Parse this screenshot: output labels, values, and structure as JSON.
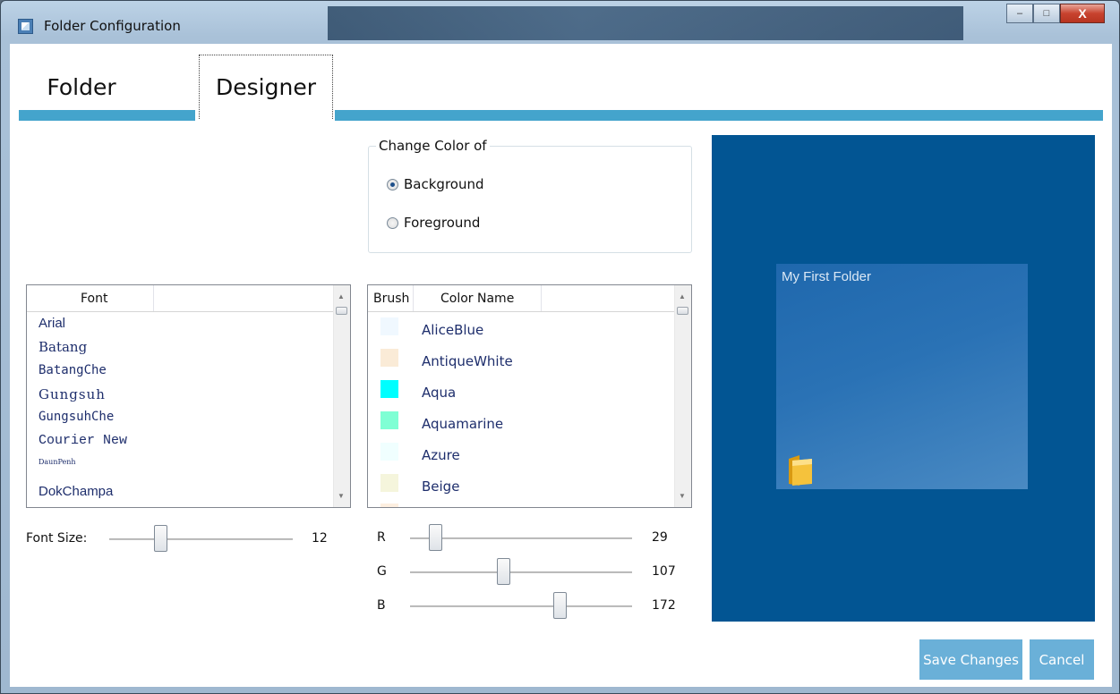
{
  "window": {
    "title": "Folder Configuration",
    "controls": {
      "minimize": "‒",
      "maximize": "□",
      "close": "X"
    }
  },
  "tabs": [
    {
      "label": "Folder",
      "selected": false
    },
    {
      "label": "Designer",
      "selected": true
    }
  ],
  "change_color": {
    "legend": "Change Color of",
    "options": [
      {
        "label": "Background",
        "checked": true
      },
      {
        "label": "Foreground",
        "checked": false
      }
    ]
  },
  "font_list": {
    "header": "Font",
    "items": [
      "Arial",
      "Batang",
      "BatangChe",
      "Gungsuh",
      "GungsuhChe",
      "Courier New",
      "DaunPenh",
      "DokChampa"
    ]
  },
  "color_list": {
    "headers": {
      "brush": "Brush",
      "name": "Color Name"
    },
    "items": [
      {
        "name": "AliceBlue",
        "hex": "#f0f8ff"
      },
      {
        "name": "AntiqueWhite",
        "hex": "#faebd7"
      },
      {
        "name": "Aqua",
        "hex": "#00ffff"
      },
      {
        "name": "Aquamarine",
        "hex": "#7fffd4"
      },
      {
        "name": "Azure",
        "hex": "#f0ffff"
      },
      {
        "name": "Beige",
        "hex": "#f5f5dc"
      }
    ]
  },
  "font_size": {
    "label": "Font Size:",
    "value": "12",
    "fraction": 0.28
  },
  "rgb": [
    {
      "label": "R",
      "value": "29",
      "fraction": 0.114
    },
    {
      "label": "G",
      "value": "107",
      "fraction": 0.42
    },
    {
      "label": "B",
      "value": "172",
      "fraction": 0.675
    }
  ],
  "preview": {
    "background": "#025593",
    "tile_title": "My First Folder"
  },
  "buttons": {
    "save": "Save Changes",
    "cancel": "Cancel"
  },
  "colors": {
    "accent": "#44a4cc",
    "button": "#6ab0d8"
  }
}
